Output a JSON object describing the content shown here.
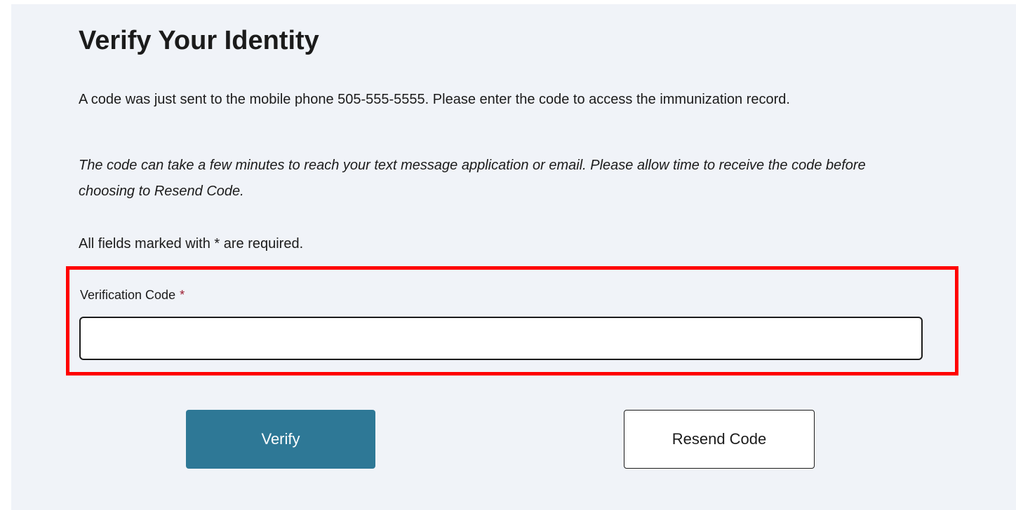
{
  "page": {
    "title": "Verify Your Identity",
    "intro_text": "A code was just sent to the mobile phone 505-555-5555. Please enter the code to access the immunization record.",
    "note_text": "The code can take a few minutes to reach your text message application or email. Please allow time to receive the code before choosing to Resend Code.",
    "required_note": "All fields marked with * are required."
  },
  "form": {
    "verification_code": {
      "label": "Verification Code",
      "required_marker": "*",
      "value": "",
      "placeholder": ""
    }
  },
  "buttons": {
    "verify_label": "Verify",
    "resend_label": "Resend Code"
  },
  "colors": {
    "panel_background": "#f0f3f8",
    "primary_button": "#2e7896",
    "highlight_outline": "#ff0000",
    "required_marker": "#9b1b30"
  }
}
